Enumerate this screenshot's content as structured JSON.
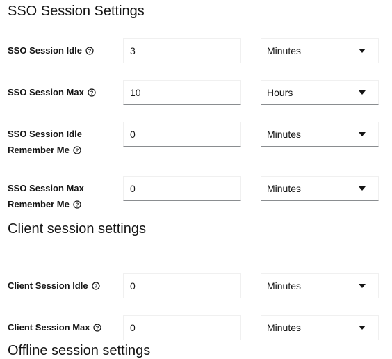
{
  "sections": {
    "sso_title": "SSO Session Settings",
    "client_title": "Client session settings",
    "offline_title": "Offline session settings"
  },
  "rows": {
    "sso_idle": {
      "label": [
        "SSO Session Idle"
      ],
      "value": "3",
      "unit": "Minutes"
    },
    "sso_max": {
      "label": [
        "SSO Session Max"
      ],
      "value": "10",
      "unit": "Hours"
    },
    "sso_idle_rm": {
      "label": [
        "SSO Session Idle",
        "Remember Me"
      ],
      "value": "0",
      "unit": "Minutes"
    },
    "sso_max_rm": {
      "label": [
        "SSO Session Max",
        "Remember Me"
      ],
      "value": "0",
      "unit": "Minutes"
    },
    "client_idle": {
      "label": [
        "Client Session Idle"
      ],
      "value": "0",
      "unit": "Minutes"
    },
    "client_max": {
      "label": [
        "Client Session Max"
      ],
      "value": "0",
      "unit": "Minutes"
    }
  },
  "icons": {
    "help": "question-circle-icon",
    "dropdown": "caret-down-icon"
  },
  "colors": {
    "text": "#151515",
    "field_border": "#8a8d90"
  }
}
